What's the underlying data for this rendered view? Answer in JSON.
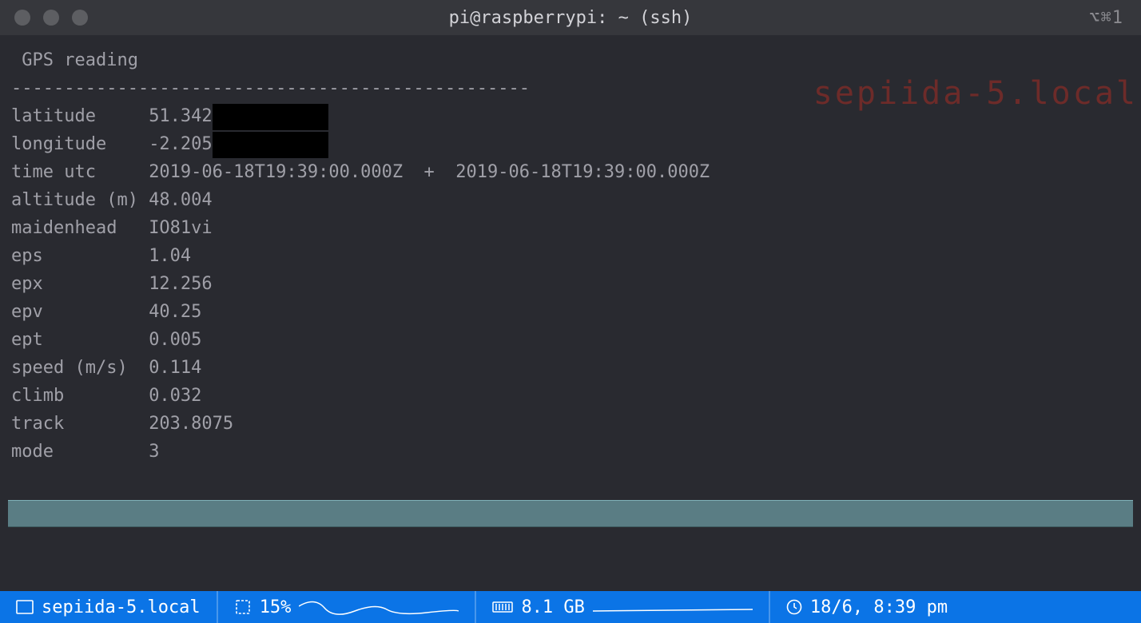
{
  "window": {
    "title": "pi@raspberrypi: ~ (ssh)",
    "corner_hint": "⌥⌘1"
  },
  "terminal": {
    "heading": " GPS reading",
    "divider": "-------------------------------------------------",
    "watermark_host": "sepiida-5.local",
    "rows": [
      {
        "label": "latitude    ",
        "value": "51.342",
        "redacted_cols": 11
      },
      {
        "label": "longitude   ",
        "value": "-2.205",
        "redacted_cols": 11
      },
      {
        "label": "time utc    ",
        "value": "2019-06-18T19:39:00.000Z  +  2019-06-18T19:39:00.000Z"
      },
      {
        "label": "altitude (m)",
        "value": "48.004"
      },
      {
        "label": "maidenhead  ",
        "value": "IO81vi"
      },
      {
        "label": "eps         ",
        "value": "1.04"
      },
      {
        "label": "epx         ",
        "value": "12.256"
      },
      {
        "label": "epv         ",
        "value": "40.25"
      },
      {
        "label": "ept         ",
        "value": "0.005"
      },
      {
        "label": "speed (m/s) ",
        "value": "0.114"
      },
      {
        "label": "climb       ",
        "value": "0.032"
      },
      {
        "label": "track       ",
        "value": "203.8075"
      },
      {
        "label": "mode        ",
        "value": "3"
      }
    ]
  },
  "statusbar": {
    "host": "sepiida-5.local",
    "cpu": "15%",
    "memory": "8.1 GB",
    "clock": "18/6, 8:39 pm"
  }
}
